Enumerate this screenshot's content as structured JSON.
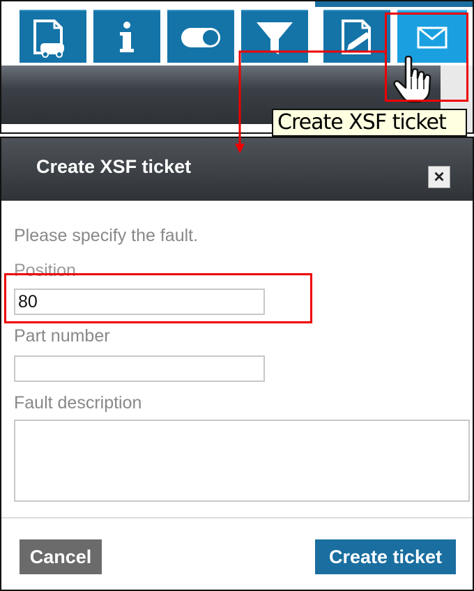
{
  "toolbar": {
    "buttons": [
      {
        "name": "vehicle-document",
        "icon": "document-car-icon"
      },
      {
        "name": "info",
        "icon": "info-icon",
        "glyph": "i"
      },
      {
        "name": "toggle",
        "icon": "toggle-icon"
      },
      {
        "name": "filter",
        "icon": "filter-icon"
      },
      {
        "name": "edit-document",
        "icon": "document-edit-icon"
      },
      {
        "name": "mail",
        "icon": "envelope-icon"
      }
    ],
    "tooltip": "Create XSF ticket"
  },
  "dialog": {
    "title": "Create XSF ticket",
    "close_label": "×",
    "instruction": "Please specify the fault.",
    "position": {
      "label": "Position",
      "value": "80"
    },
    "part_number": {
      "label": "Part number",
      "value": ""
    },
    "fault_description": {
      "label": "Fault description",
      "value": ""
    },
    "cancel_label": "Cancel",
    "submit_label": "Create ticket"
  },
  "colors": {
    "toolbar_button": "#1474a8",
    "active_button": "#1aa0e0",
    "highlight": "#e00000",
    "tooltip_bg": "#ffffe1",
    "dialog_header": "#3b4046",
    "cancel_button": "#6b6b6b",
    "submit_button": "#1a6ea0"
  }
}
